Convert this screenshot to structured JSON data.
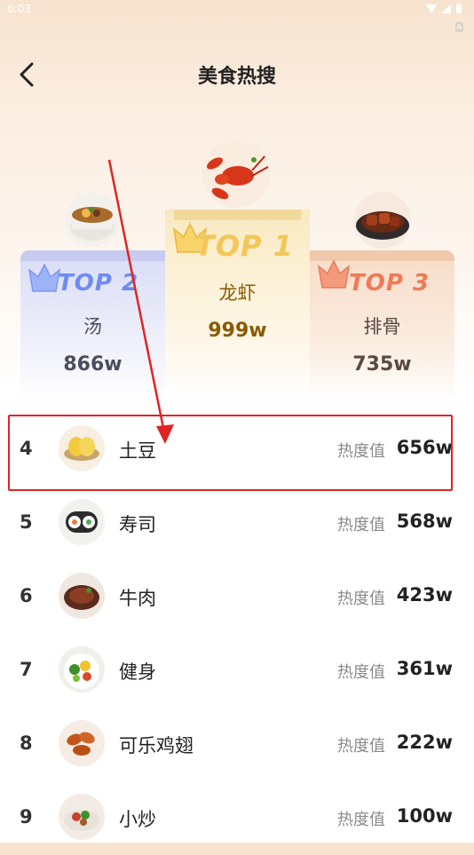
{
  "status": {
    "time": "6:03",
    "badge": "A"
  },
  "header": {
    "title": "美食热搜"
  },
  "podium": [
    {
      "rank_label": "TOP 2",
      "name": "汤",
      "heat": "866w",
      "icon": "soup-bowl-icon"
    },
    {
      "rank_label": "TOP 1",
      "name": "龙虾",
      "heat": "999w",
      "icon": "crayfish-icon"
    },
    {
      "rank_label": "TOP 3",
      "name": "排骨",
      "heat": "735w",
      "icon": "ribs-icon"
    }
  ],
  "heat_label": "热度值",
  "list": [
    {
      "rank": "4",
      "name": "土豆",
      "heat": "656w",
      "icon": "potato-icon"
    },
    {
      "rank": "5",
      "name": "寿司",
      "heat": "568w",
      "icon": "sushi-icon"
    },
    {
      "rank": "6",
      "name": "牛肉",
      "heat": "423w",
      "icon": "beef-icon"
    },
    {
      "rank": "7",
      "name": "健身",
      "heat": "361w",
      "icon": "salad-icon"
    },
    {
      "rank": "8",
      "name": "可乐鸡翅",
      "heat": "222w",
      "icon": "chicken-wings-icon"
    },
    {
      "rank": "9",
      "name": "小炒",
      "heat": "100w",
      "icon": "stir-fry-icon"
    }
  ],
  "colors": {
    "top1": "#8a5a00",
    "top2": "#4a4d5e",
    "top3": "#5a4a3e",
    "top1_rank": "#f4c65a",
    "top2_rank": "#6e8cf0",
    "top3_rank": "#ee7a55",
    "annotation": "#e02424"
  }
}
